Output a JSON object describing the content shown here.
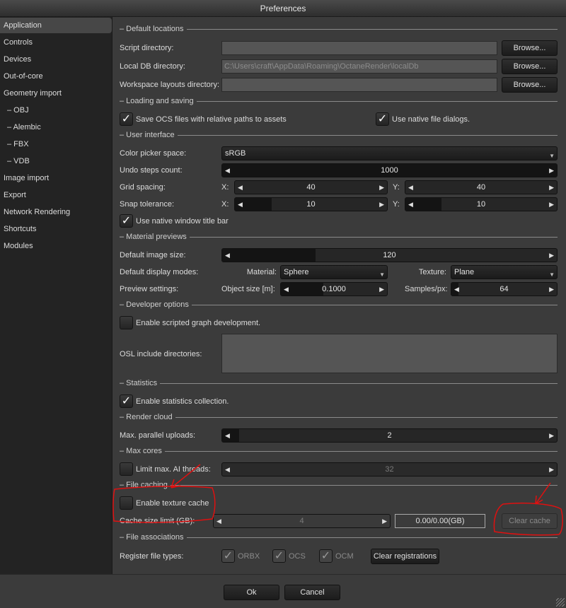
{
  "window": {
    "title": "Preferences"
  },
  "sidebar": {
    "items": [
      {
        "label": "Application",
        "selected": true
      },
      {
        "label": "Controls"
      },
      {
        "label": "Devices"
      },
      {
        "label": "Out-of-core"
      },
      {
        "label": "Geometry import"
      },
      {
        "label": "–  OBJ"
      },
      {
        "label": "–  Alembic"
      },
      {
        "label": "–  FBX"
      },
      {
        "label": "–  VDB"
      },
      {
        "label": "Image import"
      },
      {
        "label": "Export"
      },
      {
        "label": "Network Rendering"
      },
      {
        "label": "Shortcuts"
      },
      {
        "label": "Modules"
      }
    ]
  },
  "sections": {
    "default_locations": {
      "header": "– Default locations",
      "script_label": "Script directory:",
      "script_value": "",
      "localdb_label": "Local DB directory:",
      "localdb_value": "C:\\Users\\craft\\AppData\\Roaming\\OctaneRender\\localDb",
      "workspace_label": "Workspace layouts directory:",
      "workspace_value": "",
      "browse": "Browse..."
    },
    "loading": {
      "header": "– Loading and saving",
      "save_ocs": "Save OCS files with relative paths to assets",
      "save_ocs_checked": true,
      "native_dialogs": "Use native file dialogs.",
      "native_dialogs_checked": true
    },
    "ui": {
      "header": "– User interface",
      "color_picker_label": "Color picker space:",
      "color_picker_value": "sRGB",
      "undo_label": "Undo steps count:",
      "undo_value": "1000",
      "undo_level": 1,
      "grid_label": "Grid spacing:",
      "x": "X:",
      "y": "Y:",
      "grid_x": "40",
      "grid_y": "40",
      "grid_level": 1,
      "snap_label": "Snap tolerance:",
      "snap_x": "10",
      "snap_y": "10",
      "snap_level": 0.24,
      "native_title": "Use native window title bar",
      "native_title_checked": true
    },
    "material": {
      "header": "– Material previews",
      "image_size_label": "Default image size:",
      "image_size": "120",
      "image_size_level": 0.28,
      "display_modes_label": "Default display modes:",
      "material_label": "Material:",
      "material_value": "Sphere",
      "texture_label": "Texture:",
      "texture_value": "Plane",
      "preview_label": "Preview settings:",
      "object_size_label": "Object size [m]:",
      "object_size": "0.1000",
      "object_size_level": 0.4,
      "samples_label": "Samples/px:",
      "samples": "64",
      "samples_level": 0.07
    },
    "developer": {
      "header": "– Developer options",
      "scripted": "Enable scripted graph development.",
      "scripted_checked": false,
      "osl_label": "OSL include directories:"
    },
    "statistics": {
      "header": "– Statistics",
      "enable": "Enable statistics collection.",
      "enable_checked": true
    },
    "render_cloud": {
      "header": "– Render cloud",
      "uploads_label": "Max. parallel uploads:",
      "uploads": "2",
      "uploads_level": 0.05
    },
    "max_cores": {
      "header": "– Max cores",
      "limit_label": "Limit max. AI threads:",
      "limit_checked": false,
      "threads": "32"
    },
    "file_caching": {
      "header": "– File caching",
      "enable": "Enable texture cache",
      "enable_checked": false,
      "limit_label": "Cache size limit (GB):",
      "limit": "4",
      "usage": "0.00/0.00(GB)",
      "clear": "Clear cache"
    },
    "file_assoc": {
      "header": "– File associations",
      "register_label": "Register file types:",
      "types": [
        "ORBX",
        "OCS",
        "OCM"
      ],
      "clear": "Clear registrations"
    }
  },
  "footer": {
    "ok": "Ok",
    "cancel": "Cancel"
  },
  "annotation_color": "#e01010"
}
